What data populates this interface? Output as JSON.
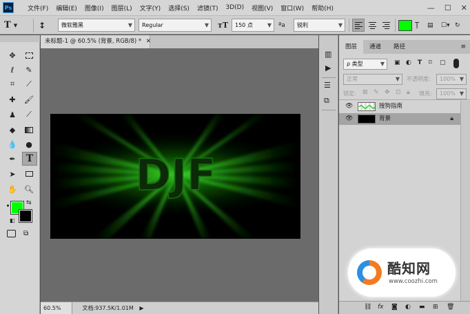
{
  "app": {
    "logo": "Ps"
  },
  "menu": [
    "文件(F)",
    "编辑(E)",
    "图像(I)",
    "图层(L)",
    "文字(Y)",
    "选择(S)",
    "滤镜(T)",
    "3D(D)",
    "视图(V)",
    "窗口(W)",
    "帮助(H)"
  ],
  "window_controls": {
    "minimize": "—",
    "maximize": "☐",
    "close": "✕"
  },
  "options": {
    "font_family": "微软雅黑",
    "font_style": "Regular",
    "font_size": "150 点",
    "aa_label": "ªa",
    "antialias": "锐利",
    "text_color": "#00ff00"
  },
  "document": {
    "tab_title": "未标题-1 @ 60.5% (背景, RGB/8) *",
    "zoom": "60.5%",
    "doc_info": "文档:937.5K/1.01M",
    "canvas_text": "DJF"
  },
  "colors": {
    "foreground": "#00ff00",
    "background": "#000000"
  },
  "layers_panel": {
    "tabs": [
      "图层",
      "通道",
      "路径"
    ],
    "filter_label": "ρ 类型",
    "blend_mode": "正常",
    "opacity_label": "不透明度:",
    "opacity_value": "100%",
    "lock_label": "锁定:",
    "fill_label": "填充:",
    "fill_value": "100%",
    "layers": [
      {
        "name": "搜狗指南",
        "selected": false
      },
      {
        "name": "背景",
        "selected": true,
        "locked": true
      }
    ],
    "bottom_icons": [
      "link-icon",
      "fx-icon",
      "mask-icon",
      "adjustment-icon",
      "group-icon",
      "new-layer-icon",
      "trash-icon"
    ]
  },
  "watermark": {
    "title": "酷知网",
    "url": "www.coozhi.com"
  }
}
